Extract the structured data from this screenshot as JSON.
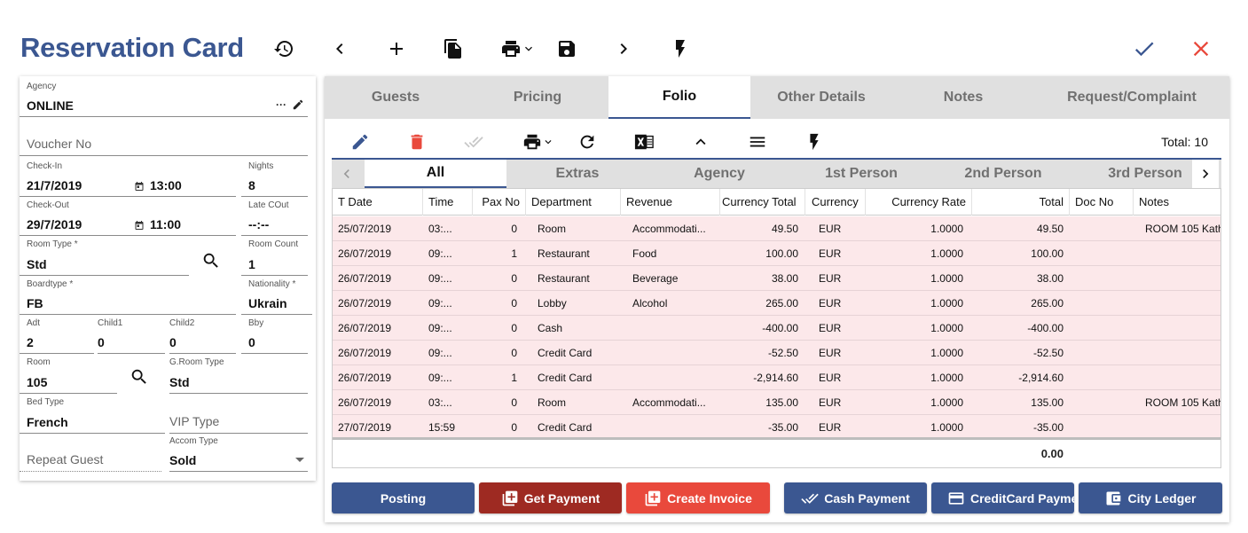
{
  "header": {
    "title": "Reservation Card"
  },
  "form": {
    "agency": {
      "label": "Agency",
      "value": "ONLINE",
      "dots": "···"
    },
    "voucher": {
      "placeholder": "Voucher No"
    },
    "checkin": {
      "label": "Check-In",
      "date": "21/7/2019",
      "time": "13:00"
    },
    "nights": {
      "label": "Nights",
      "value": "8"
    },
    "checkout": {
      "label": "Check-Out",
      "date": "29/7/2019",
      "time": "11:00"
    },
    "late": {
      "label": "Late COut",
      "value": "--:--"
    },
    "room_type": {
      "label": "Room Type *",
      "value": "Std"
    },
    "room_count": {
      "label": "Room Count",
      "value": "1"
    },
    "boardtype": {
      "label": "Boardtype *",
      "value": "FB"
    },
    "nationality": {
      "label": "Nationality *",
      "value": "Ukrain"
    },
    "adt": {
      "label": "Adt",
      "value": "2"
    },
    "child1": {
      "label": "Child1",
      "value": "0"
    },
    "child2": {
      "label": "Child2",
      "value": "0"
    },
    "bby": {
      "label": "Bby",
      "value": "0"
    },
    "room": {
      "label": "Room",
      "value": "105"
    },
    "groom_type": {
      "label": "G.Room Type",
      "value": "Std"
    },
    "bed_type": {
      "label": "Bed Type",
      "value": "French"
    },
    "vip": {
      "placeholder": "VIP Type"
    },
    "repeat": {
      "placeholder": "Repeat Guest"
    },
    "accom": {
      "label": "Accom Type",
      "value": "Sold"
    }
  },
  "tabs": [
    "Guests",
    "Pricing",
    "Folio",
    "Other Details",
    "Notes",
    "Request/Complaint"
  ],
  "folio": {
    "total_label": "Total: 10",
    "subtabs": [
      "All",
      "Extras",
      "Agency",
      "1st Person",
      "2nd Person",
      "3rd Person"
    ],
    "columns": [
      "T Date",
      "Time",
      "Pax No",
      "Department",
      "Revenue",
      "Currency Total",
      "Currency",
      "Currency Rate",
      "Total",
      "Doc No",
      "Notes"
    ],
    "rows": [
      [
        "25/07/2019",
        "03:...",
        "0",
        "Room",
        "Accommodati...",
        "49.50",
        "EUR",
        "1.0000",
        "49.50",
        "",
        "ROOM 105 Kath"
      ],
      [
        "26/07/2019",
        "09:...",
        "1",
        "Restaurant",
        "Food",
        "100.00",
        "EUR",
        "1.0000",
        "100.00",
        "",
        ""
      ],
      [
        "26/07/2019",
        "09:...",
        "0",
        "Restaurant",
        "Beverage",
        "38.00",
        "EUR",
        "1.0000",
        "38.00",
        "",
        ""
      ],
      [
        "26/07/2019",
        "09:...",
        "0",
        "Lobby",
        "Alcohol",
        "265.00",
        "EUR",
        "1.0000",
        "265.00",
        "",
        ""
      ],
      [
        "26/07/2019",
        "09:...",
        "0",
        "Cash",
        "",
        "-400.00",
        "EUR",
        "1.0000",
        "-400.00",
        "",
        ""
      ],
      [
        "26/07/2019",
        "09:...",
        "0",
        "Credit Card",
        "",
        "-52.50",
        "EUR",
        "1.0000",
        "-52.50",
        "",
        ""
      ],
      [
        "26/07/2019",
        "09:...",
        "1",
        "Credit Card",
        "",
        "-2,914.60",
        "EUR",
        "1.0000",
        "-2,914.60",
        "",
        ""
      ],
      [
        "26/07/2019",
        "03:...",
        "0",
        "Room",
        "Accommodati...",
        "135.00",
        "EUR",
        "1.0000",
        "135.00",
        "",
        "ROOM 105 Kath"
      ],
      [
        "27/07/2019",
        "15:59",
        "0",
        "Credit Card",
        "",
        "-35.00",
        "EUR",
        "1.0000",
        "-35.00",
        "",
        ""
      ]
    ],
    "footer_total": "0.00"
  },
  "buttons": {
    "posting": "Posting",
    "get_payment": "Get Payment",
    "create_invoice": "Create Invoice",
    "cash_payment": "Cash Payment",
    "creditcard_payment": "CreditCard Payme",
    "city_ledger": "City Ledger"
  },
  "colors": {
    "brand": "#3b5791",
    "confirm": "#3b5791",
    "cancel": "#e9493c",
    "row_bg": "#fce8ea"
  }
}
